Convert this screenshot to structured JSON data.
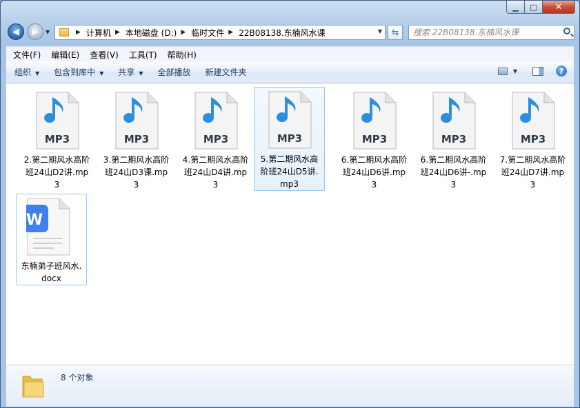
{
  "address": {
    "crumbs": [
      "计算机",
      "本地磁盘 (D:)",
      "临时文件",
      "22B08138.东楠风水课"
    ]
  },
  "search": {
    "placeholder": "搜索 22B08138.东楠风水课"
  },
  "menubar": [
    "文件(F)",
    "编辑(E)",
    "查看(V)",
    "工具(T)",
    "帮助(H)"
  ],
  "commands": {
    "organize": "组织",
    "include_in_library": "包含到库中",
    "share": "共享",
    "play_all": "全部播放",
    "new_folder": "新建文件夹"
  },
  "files": [
    {
      "name": "2.第二期风水高阶班24山D2讲.mp3",
      "icon": "mp3-file-icon",
      "badge": "MP3"
    },
    {
      "name": "3.第二期风水高阶班24山D3课.mp3",
      "icon": "mp3-file-icon",
      "badge": "MP3"
    },
    {
      "name": "4.第二期风水高阶班24山D4讲.mp3",
      "icon": "mp3-file-icon",
      "badge": "MP3"
    },
    {
      "name": "5.第二期风水高阶班24山D5讲.mp3",
      "icon": "mp3-file-icon",
      "badge": "MP3"
    },
    {
      "name": "6.第二期风水高阶班24山D6讲.mp3",
      "icon": "mp3-file-icon",
      "badge": "MP3"
    },
    {
      "name": "6.第二期风水高阶班24山D6讲-.mp3",
      "icon": "mp3-file-icon",
      "badge": "MP3"
    },
    {
      "name": "7.第二期风水高阶班24山D7讲.mp3",
      "icon": "mp3-file-icon",
      "badge": "MP3"
    },
    {
      "name": "东楠弟子班风水.docx",
      "icon": "wps-docx-icon",
      "badge": "W"
    }
  ],
  "status": {
    "count": "8 个对象"
  },
  "colors": {
    "accent": "#2e6fc0",
    "music_note": "#2b8fe0",
    "wps_blue": "#3f7ff0",
    "selection": "#e5f1fc"
  }
}
